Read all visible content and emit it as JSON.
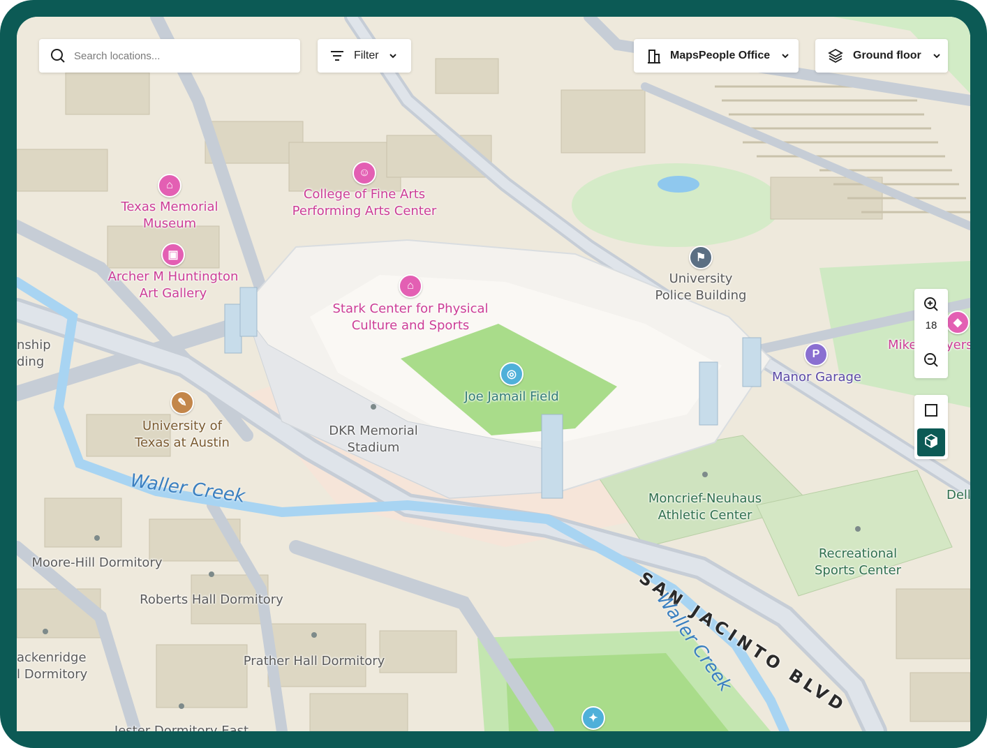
{
  "search": {
    "placeholder": "Search locations..."
  },
  "filter": {
    "label": "Filter"
  },
  "venue": {
    "label": "MapsPeople Office"
  },
  "floor": {
    "label": "Ground floor"
  },
  "zoom": {
    "level": "18"
  },
  "map": {
    "pois": {
      "texas_memorial": [
        "Texas Memorial",
        "Museum"
      ],
      "fine_arts": [
        "College of Fine Arts",
        "Performing Arts Center"
      ],
      "huntington": [
        "Archer M Huntington",
        "Art Gallery"
      ],
      "stark": [
        "Stark Center for Physical",
        "Culture and Sports"
      ],
      "police": [
        "University",
        "Police Building"
      ],
      "jamail": "Joe Jamail Field",
      "dkr": [
        "DKR Memorial",
        "Stadium"
      ],
      "ut_austin": [
        "University of",
        "Texas at Austin"
      ],
      "manor": "Manor Garage",
      "mike": "Mike",
      "myers": "yers",
      "moncrief": [
        "Moncrief-Neuhaus",
        "Athletic Center"
      ],
      "rec_sports": [
        "Recreational",
        "Sports Center"
      ],
      "dell": "Dell",
      "moore_hill": "Moore-Hill Dormitory",
      "roberts": "Roberts Hall Dormitory",
      "prather": "Prather Hall Dormitory",
      "brackenridge": [
        "ackenridge",
        "l Dormitory"
      ],
      "township": [
        "nship",
        "ding"
      ],
      "jester": "Jester Dormitory East"
    },
    "streets": {
      "san_jacinto": "SAN JACINTO BLVD"
    },
    "waterways": {
      "waller_creek_1": "Waller Creek",
      "waller_creek_2": "Waller Creek"
    }
  },
  "colors": {
    "frame": "#0c5a55",
    "pink_poi": "#e35fb3",
    "field": "#a9dc8a",
    "creek": "#a8d4f2"
  }
}
